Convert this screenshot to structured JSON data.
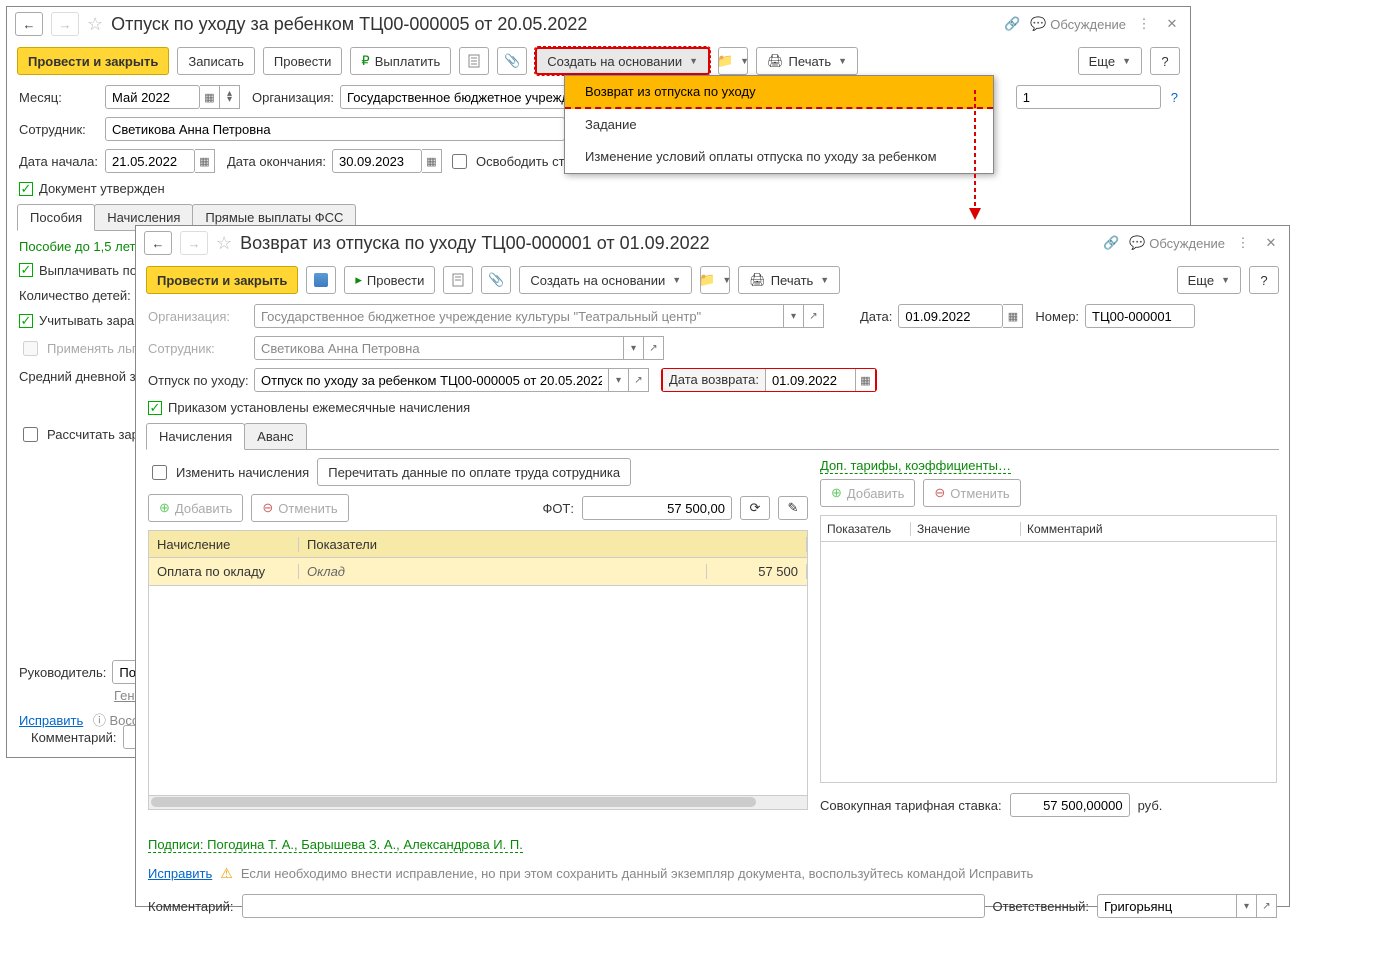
{
  "win1": {
    "title": "Отпуск по уходу за ребенком ТЦ00-000005 от 20.05.2022",
    "discuss": "Обсуждение",
    "toolbar": {
      "post_close": "Провести и закрыть",
      "save": "Записать",
      "post": "Провести",
      "pay": "Выплатить",
      "create_base": "Создать на основании",
      "print": "Печать",
      "more": "Еще",
      "help": "?"
    },
    "dropdown": {
      "item1": "Возврат из отпуска по уходу",
      "item2": "Задание",
      "item3": "Изменение условий оплаты отпуска по уходу за ребенком"
    },
    "form": {
      "month_lbl": "Месяц:",
      "month_val": "Май 2022",
      "org_lbl": "Организация:",
      "org_val": "Государственное бюджетное учрежден",
      "num_val": "1",
      "num_help": "?",
      "emp_lbl": "Сотрудник:",
      "emp_val": "Светикова Анна Петровна",
      "start_lbl": "Дата начала:",
      "start_val": "21.05.2022",
      "end_lbl": "Дата окончания:",
      "end_val": "30.09.2023",
      "free_rate": "Освободить ста",
      "approved": "Документ утвержден"
    },
    "tabs": {
      "t1": "Пособия",
      "t2": "Начисления",
      "t3": "Прямые выплаты ФСС"
    },
    "panel": {
      "hdr": "Пособие до 1,5 лет",
      "pay_benefit": "Выплачивать по",
      "children_lbl": "Количество детей:",
      "consider_earn": "Учитывать зара",
      "apply_benefit": "Применять льго",
      "avg_daily": "Средний дневной з",
      "calc_earn": "Рассчитать зар"
    },
    "bottom": {
      "manager_lbl": "Руководитель:",
      "manager_val": "Пого",
      "gener": "Генер",
      "fix": "Исправить",
      "restore": "Восс",
      "comment_lbl": "Комментарий:"
    }
  },
  "win2": {
    "title": "Возврат из отпуска по уходу ТЦ00-000001 от 01.09.2022",
    "discuss": "Обсуждение",
    "toolbar": {
      "post_close": "Провести и закрыть",
      "post": "Провести",
      "create_base": "Создать на основании",
      "print": "Печать",
      "more": "Еще",
      "help": "?"
    },
    "form": {
      "org_lbl": "Организация:",
      "org_val": "Государственное бюджетное учреждение культуры \"Театральный центр\"",
      "date_lbl": "Дата:",
      "date_val": "01.09.2022",
      "num_lbl": "Номер:",
      "num_val": "ТЦ00-000001",
      "emp_lbl": "Сотрудник:",
      "emp_val": "Светикова Анна Петровна",
      "leave_lbl": "Отпуск по уходу:",
      "leave_val": "Отпуск по уходу за ребенком ТЦ00-000005 от 20.05.2022",
      "return_lbl": "Дата возврата:",
      "return_val": "01.09.2022",
      "monthly_accruals": "Приказом установлены ежемесячные начисления"
    },
    "tabs": {
      "t1": "Начисления",
      "t2": "Аванс"
    },
    "panel": {
      "change_accruals": "Изменить начисления",
      "reread": "Перечитать данные по оплате труда сотрудника",
      "add": "Добавить",
      "cancel": "Отменить",
      "fot_lbl": "ФОТ:",
      "fot_val": "57 500,00",
      "extra_tariffs": "Доп. тарифы, коэффициенты…",
      "table": {
        "col1": "Начисление",
        "col2": "Показатели",
        "r1c1": "Оплата по окладу",
        "r1c2": "Оклад",
        "r1c3": "57 500"
      },
      "side": {
        "col1": "Показатель",
        "col2": "Значение",
        "col3": "Комментарий"
      },
      "total_rate_lbl": "Совокупная тарифная ставка:",
      "total_rate_val": "57 500,00000",
      "rub": "руб."
    },
    "footer": {
      "signatures": "Подписи: Погодина Т. А., Барышева З. А., Александрова И. П.",
      "fix": "Исправить",
      "fix_msg": "Если необходимо внести исправление, но при этом сохранить данный экземпляр документа, воспользуйтесь командой Исправить",
      "comment_lbl": "Комментарий:",
      "resp_lbl": "Ответственный:",
      "resp_val": "Григорьянц"
    }
  }
}
